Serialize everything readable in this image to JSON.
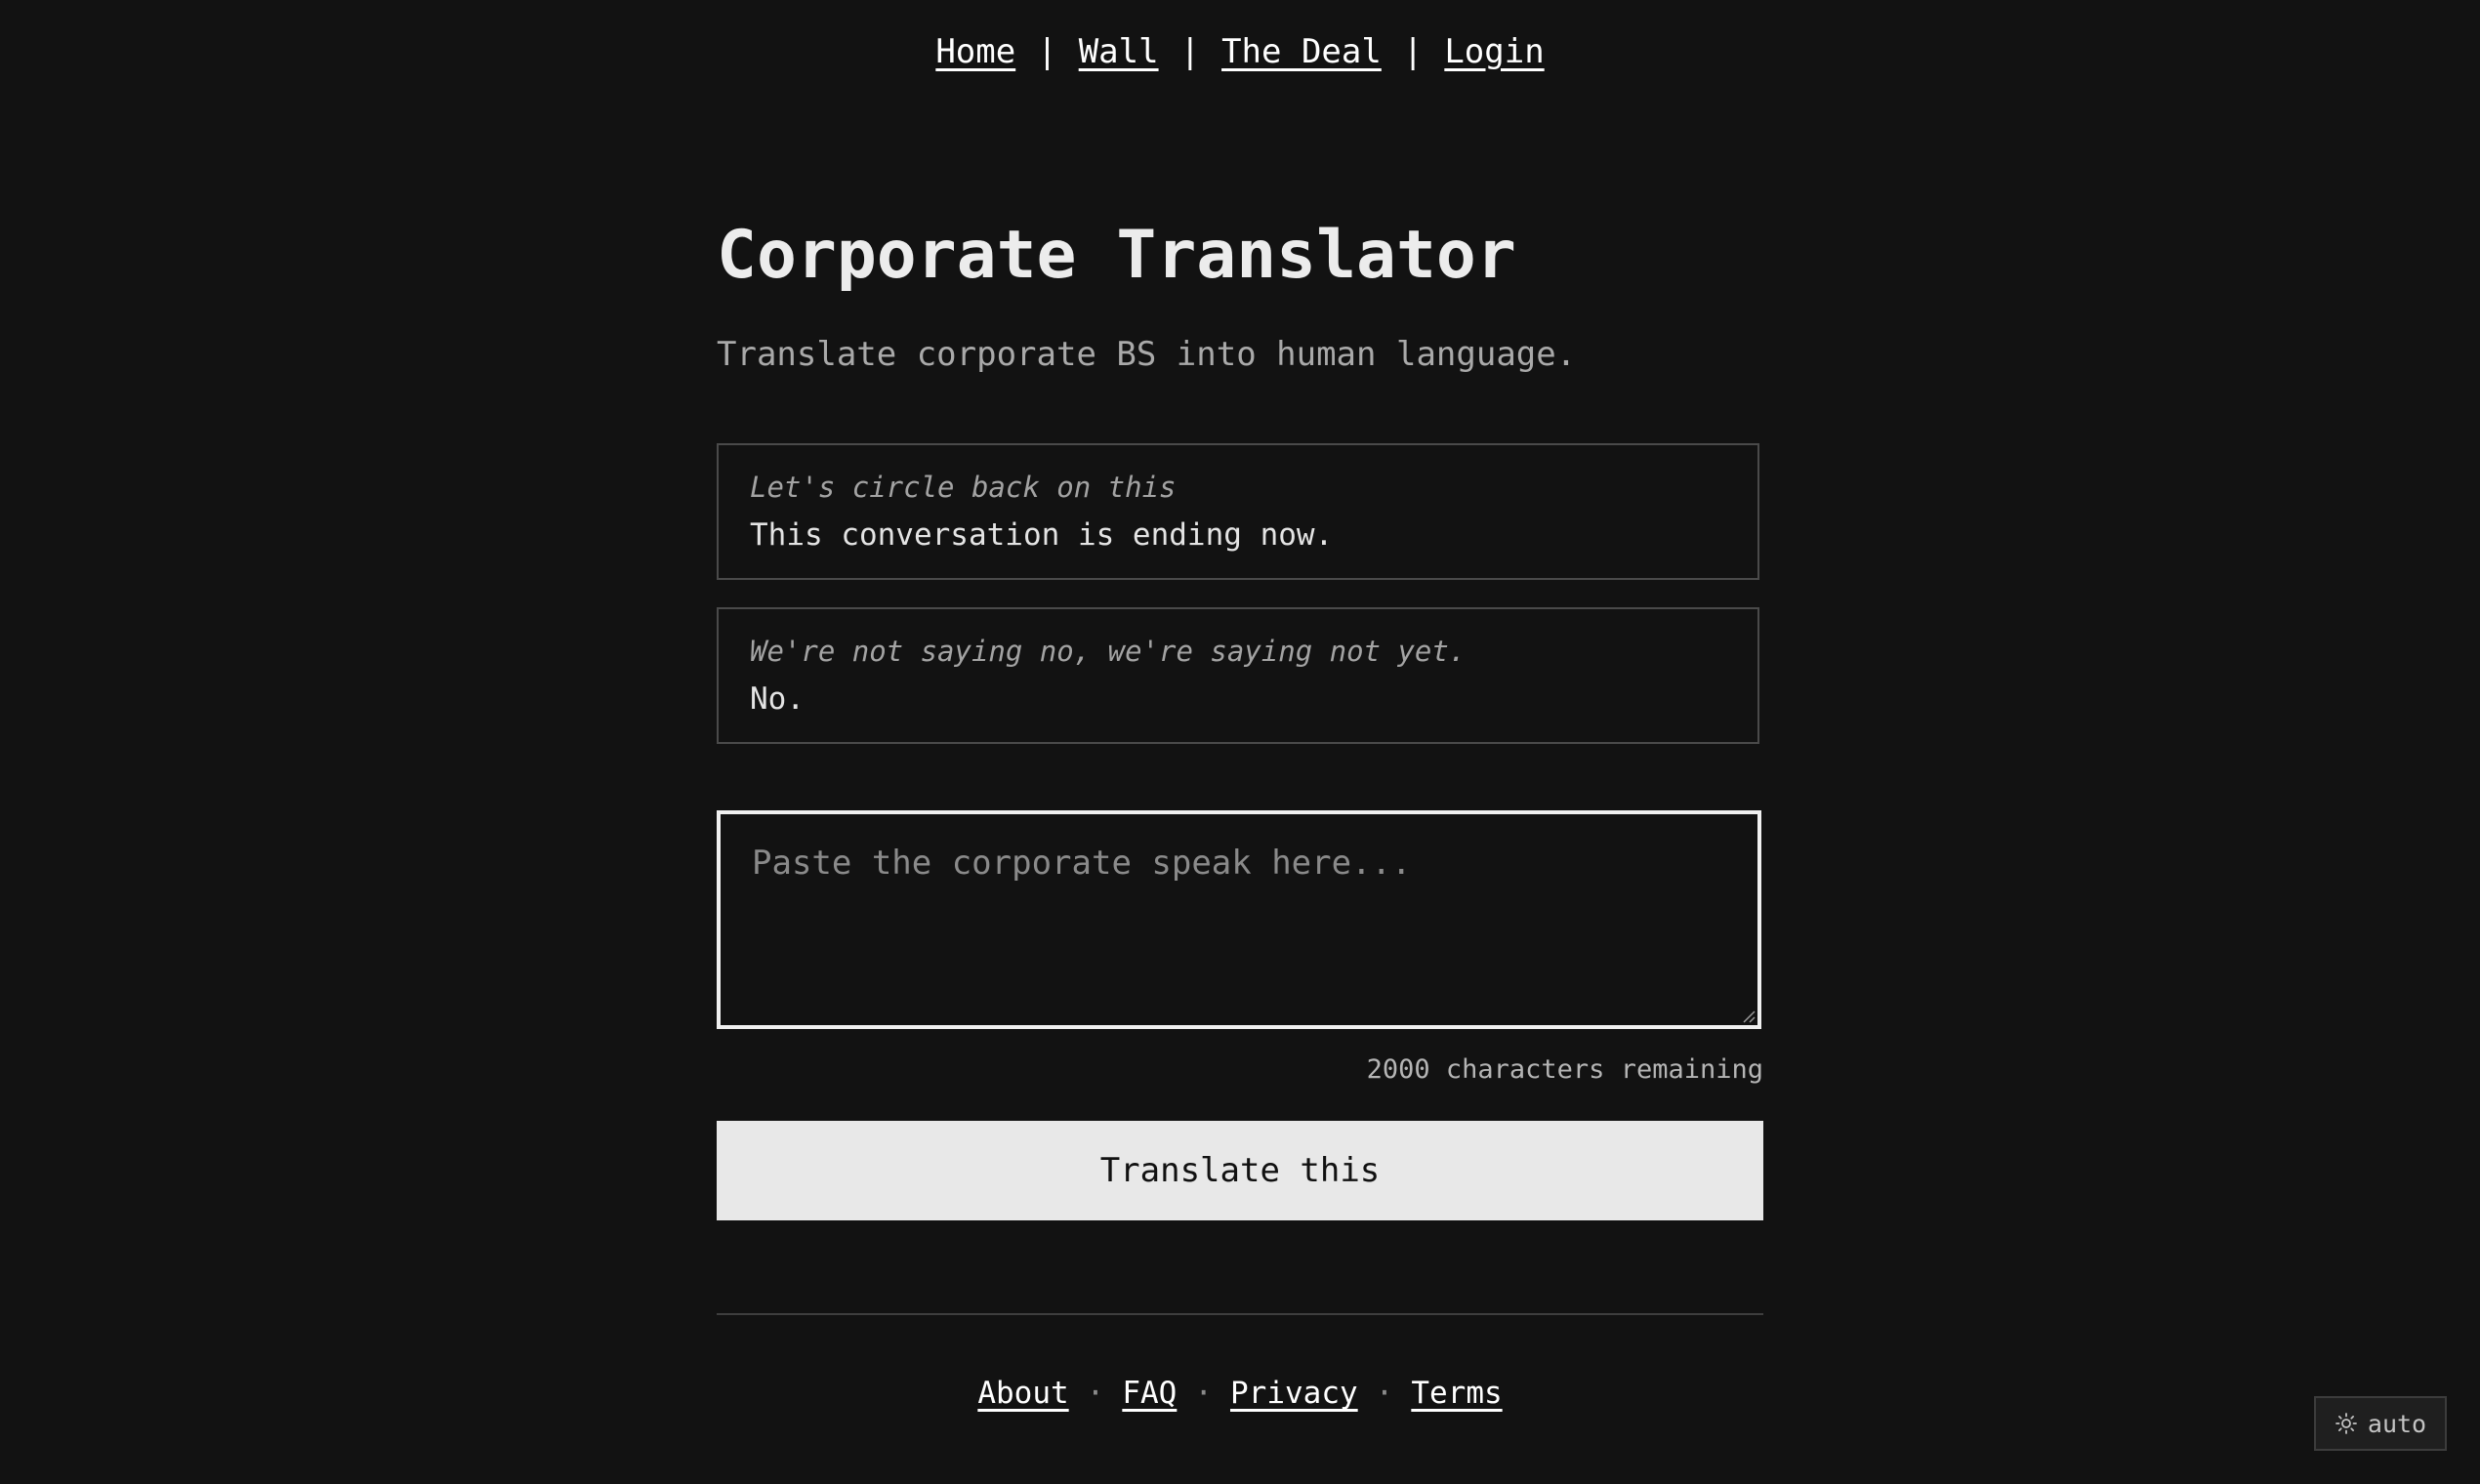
{
  "nav": {
    "items": [
      {
        "label": "Home"
      },
      {
        "label": "Wall"
      },
      {
        "label": "The Deal"
      },
      {
        "label": "Login"
      }
    ],
    "separator": "|"
  },
  "header": {
    "title": "Corporate Translator",
    "subtitle": "Translate corporate BS into human language."
  },
  "examples": [
    {
      "quote": "Let's circle back on this",
      "translation": "This conversation is ending now."
    },
    {
      "quote": "We're not saying no, we're saying not yet.",
      "translation": "No."
    }
  ],
  "input": {
    "placeholder": "Paste the corporate speak here...",
    "value": ""
  },
  "counter": {
    "text": "2000 characters remaining"
  },
  "translate_button": {
    "label": "Translate this"
  },
  "footer": {
    "links": [
      {
        "label": "About"
      },
      {
        "label": "FAQ"
      },
      {
        "label": "Privacy"
      },
      {
        "label": "Terms"
      }
    ],
    "separator": "·"
  },
  "theme_toggle": {
    "label": "auto",
    "icon": "sun-icon"
  },
  "colors": {
    "background": "#121212",
    "text": "#e6e6e6",
    "muted": "#a9a9a9",
    "button_bg": "#e8e8e8",
    "border": "#4a4a4a"
  }
}
